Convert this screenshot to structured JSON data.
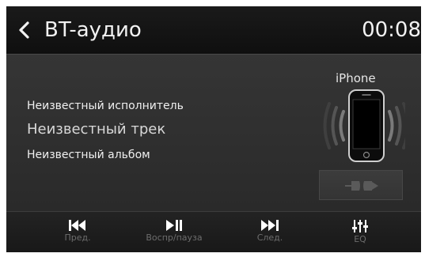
{
  "header": {
    "title": "BT-аудио",
    "time": "00:08"
  },
  "track": {
    "artist": "Неизвестный исполнитель",
    "title": "Неизвестный трек",
    "album": "Неизвестный альбом"
  },
  "device": {
    "name": "iPhone"
  },
  "controls": [
    {
      "label": "Пред.",
      "icon": "skip-previous-icon"
    },
    {
      "label": "Воспр/пауза",
      "icon": "play-pause-icon"
    },
    {
      "label": "След.",
      "icon": "skip-next-icon"
    },
    {
      "label": "EQ",
      "icon": "equalizer-icon"
    }
  ]
}
